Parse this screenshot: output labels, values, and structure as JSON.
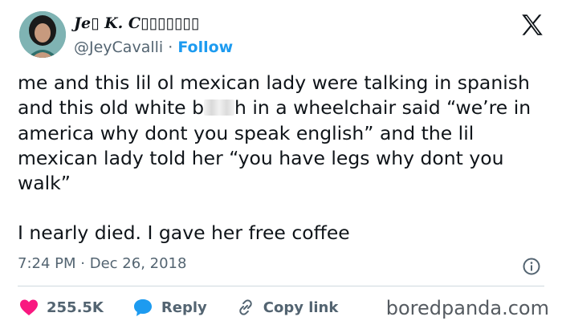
{
  "author": {
    "display_name": "Je▯ K. C▯▯▯▯▯▯▯",
    "handle": "@JeyCavalli",
    "separator": "·",
    "follow_label": "Follow"
  },
  "tweet": {
    "line_1_part_1": "me and this lil ol mexican lady were talking in spanish and this old white b",
    "line_1_part_2": "h in a wheelchair said “we’re in america why dont you speak english” and the lil mexican lady told her “you have legs why dont you walk”",
    "line_2": "I nearly died. I gave her free coffee"
  },
  "meta": {
    "time": "7:24 PM",
    "separator": "·",
    "date": "Dec 26, 2018"
  },
  "actions": {
    "likes": "255.5K",
    "reply_label": "Reply",
    "copy_label": "Copy link"
  },
  "watermark": "boredpanda.com",
  "colors": {
    "like": "#f91880",
    "reply": "#1d9bf0",
    "link": "#1d9bf0",
    "text": "#0f1419",
    "muted": "#536471"
  }
}
